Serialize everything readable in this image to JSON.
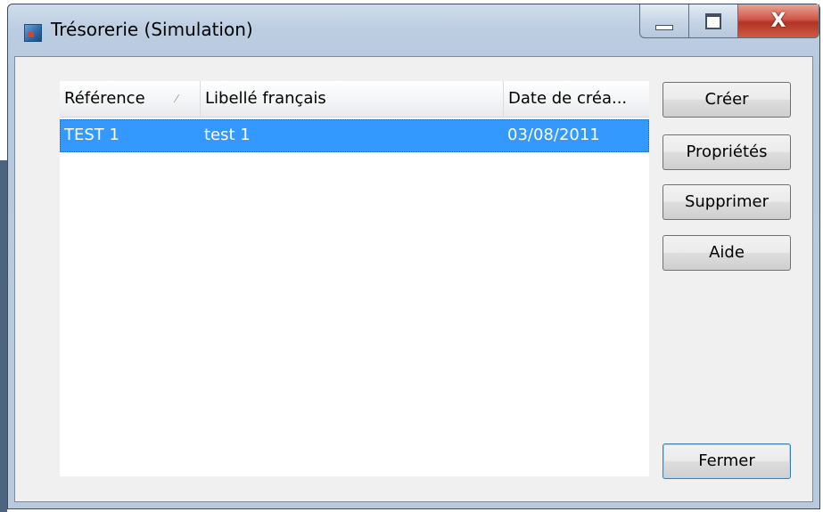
{
  "window": {
    "title": "Trésorerie (Simulation)",
    "close_glyph": "X",
    "icons": {
      "app": "app-icon",
      "minimize": "minimize-icon",
      "maximize": "maximize-icon",
      "close": "close-icon"
    }
  },
  "list": {
    "columns": [
      {
        "label": "Référence",
        "sort": "ascending"
      },
      {
        "label": "Libellé français"
      },
      {
        "label": "Date de créa..."
      }
    ],
    "sort_glyph": "⁄",
    "rows": [
      {
        "reference": "TEST 1",
        "libelle": "test 1",
        "date": "03/08/2011",
        "selected": true
      }
    ],
    "selection_color": "#3399ff"
  },
  "buttons": {
    "create": "Créer",
    "properties": "Propriétés",
    "delete": "Supprimer",
    "help": "Aide",
    "close": "Fermer"
  }
}
